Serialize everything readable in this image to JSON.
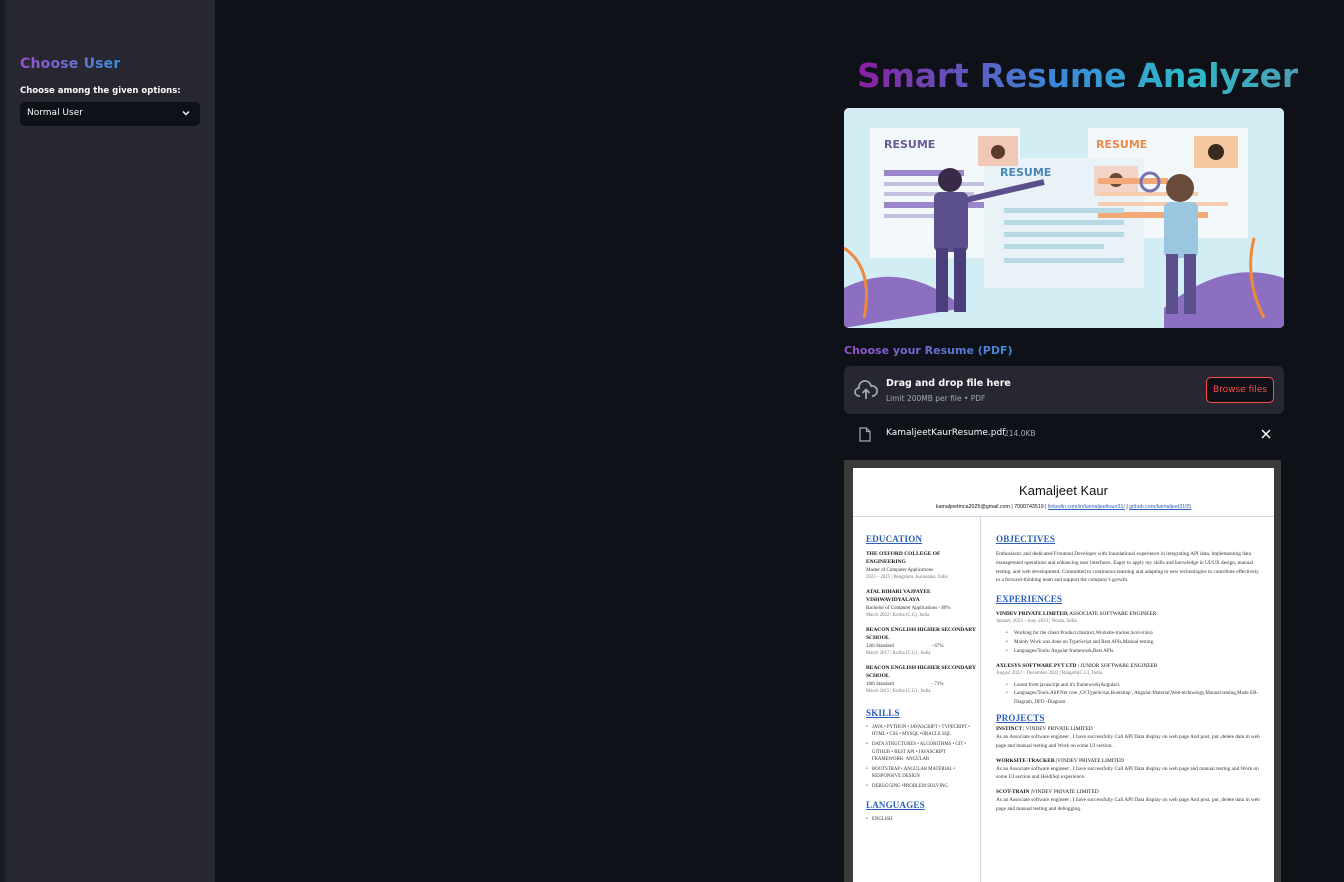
{
  "sidebar": {
    "title": "Choose User",
    "select_label": "Choose among the given options:",
    "select_value": "Normal User"
  },
  "main": {
    "title": "Smart Resume Analyzer",
    "hero_image": {
      "signs": [
        "RESUME",
        "RESUME",
        "RESUME"
      ]
    },
    "upload": {
      "label": "Choose your Resume (PDF)",
      "drop_text": "Drag and drop file here",
      "limit_text": "Limit 200MB per file • PDF",
      "browse_label": "Browse files"
    },
    "file": {
      "name": "KamaljeetKaurResume.pdf",
      "size": "214.0KB"
    }
  },
  "resume": {
    "name": "Kamaljeet Kaur",
    "contact": {
      "email_phone": "kamaljeetmca2025@gmail.com | 7000743519 |",
      "linkedin": "linkedin.com/in/kamaljeetkaur31/",
      "sep": "|",
      "github": "github.com/kamaljeet3105"
    },
    "left": {
      "education_title": "EDUCATION",
      "edu": [
        {
          "inst": "THE OXFORD COLLEGE OF ENGINEERING",
          "deg": "Master of Computer Applications",
          "date": "2023 – 2025 | Bengaluru, Karnataka, India"
        },
        {
          "inst": "ATAL BIHARI VAJPAYEE VISHWAVIDYALAYA",
          "deg": "Bachelor of Computer Applications - 80%",
          "date": "March 2022 | Korba (C.G), India"
        },
        {
          "inst": "BEACON ENGLISH HIGHER SECONDARY SCHOOL",
          "deg": "12th Standard                              - 67%",
          "date": "March 2017 | Korba (C.G) , India"
        },
        {
          "inst": "BEACON ENGLISH HIGHER SECONDARY SCHOOL",
          "deg": "10th Standard                              - 71%",
          "date": "March 2015 | Korba (C.G) , India"
        }
      ],
      "skills_title": "SKILLS",
      "skills": [
        "JAVA  • PYTHON  • JAVASCRIPT • TYPECRIPT  • HTML • CSS  • MYSQL •ORACLE SQL",
        "DATA STRUCTURES  • ALGORITHMS  • GIT • GITHUB • REST API  • JAVASCRIPT FRAMEWORK- ANGULAR",
        "BOOTSTRAP •  ANGULAR MATERIAL • RESPONSIVE DESIGN",
        "DEBUGGING •PROBLEM SOLVING"
      ],
      "languages_title": "LANGUAGES",
      "languages": [
        "ENGLISH"
      ]
    },
    "right": {
      "objectives_title": "OBJECTIVES",
      "objectives_text": "Enthusiastic and dedicated Frontend Developer with foundational experience in integrating API data, implementing data management operations  and enhancing user interfaces. Eager to apply my skills and knowledge in UI/UX design, manual testing, and web development. Committed to continuous learning and adapting to new technologies to contribute effectively to a forward-thinking team and support the company's growth.",
      "experiences_title": "EXPERIENCES",
      "jobs": [
        {
          "company": "VINDEV PRIVATE LIMITED",
          "role": "| ASSOCIATE SOFTWARE ENGINEER",
          "date": "January 2023 – may-2023 | Noida, India",
          "bullets": [
            "Working for the client Product.(Instinct,Worksite-tracker,Scot-train)",
            "Mainly Work was done on TypeScript and Rest APIs,Manual testing.",
            "Languages/Tools: Angular-framework,Rest APIs."
          ]
        },
        {
          "company": "AXLESYS SOFTWARE PVT LTD",
          "role": "| JUNIOR SOFTWARE ENGINEER",
          "date": "August 2022 – December 2022 | Raigarh(C.G), India",
          "bullets": [
            "Learnt from javascript and it's framework(Angular).",
            "Languages/Tools.ASP.Net core ,C#.TypeScript,Bootstrap , Angular-Material,Web-technology,Manual testing,Made ER-Diagram, DFD -Diagram."
          ]
        }
      ],
      "projects_title": "PROJECTS",
      "projects": [
        {
          "name": "INSTINCT",
          "org": " | VINDEV PRIVATE LIMITED",
          "text": "As an Associate software engineer , I have successfully Call API Data display on web page And post, put ,delete data in web page and manual testing and Work on some UI section ."
        },
        {
          "name": "WORKSITE-TRACKER",
          "org": " |VINDEV PRIVATE LIMITED",
          "text": " As an Associate software engineer , I have successfully Call API Data display on web page and manual testing and Work on some UI section and HeidiSql experience."
        },
        {
          "name": "SCOT-TRAIN",
          "org": " |VINDEV PRIVATE LIMITED",
          "text": "As an Associate software engineer , I have successfully Call API Data display on web page And post, put ,delete data in web page and manual testing and debugging."
        }
      ]
    }
  },
  "colors": {
    "background": "#0e1117",
    "sidebar": "#262730",
    "accent_red": "#ff4b4b",
    "link_blue": "#2a5fb8"
  }
}
